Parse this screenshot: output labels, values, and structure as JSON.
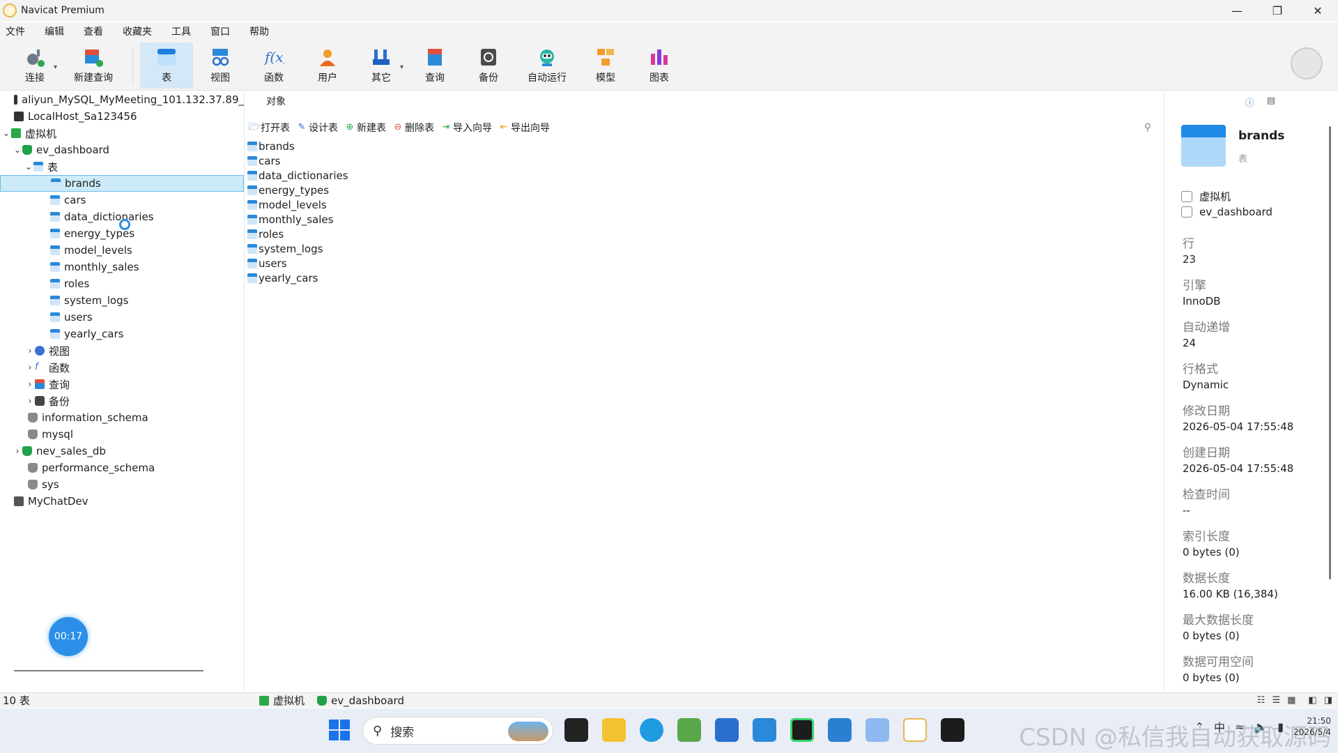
{
  "titlebar": {
    "title": "Navicat Premium"
  },
  "menu": [
    "文件",
    "编辑",
    "查看",
    "收藏夹",
    "工具",
    "窗口",
    "帮助"
  ],
  "toolbar": {
    "buttons": [
      {
        "label": "连接",
        "icon": "plug-icon"
      },
      {
        "label": "新建查询",
        "icon": "new-query-icon"
      },
      {
        "label": "表",
        "icon": "table-icon"
      },
      {
        "label": "视图",
        "icon": "view-icon"
      },
      {
        "label": "函数",
        "icon": "function-icon"
      },
      {
        "label": "用户",
        "icon": "user-icon"
      },
      {
        "label": "其它",
        "icon": "tools-icon"
      },
      {
        "label": "查询",
        "icon": "query-icon"
      },
      {
        "label": "备份",
        "icon": "backup-icon"
      },
      {
        "label": "自动运行",
        "icon": "robot-icon"
      },
      {
        "label": "模型",
        "icon": "model-icon"
      },
      {
        "label": "图表",
        "icon": "chart-icon"
      }
    ]
  },
  "tree": {
    "connections": [
      {
        "label": "aliyun_MySQL_MyMeeting_101.132.37.89_"
      },
      {
        "label": "LocalHost_Sa123456"
      },
      {
        "label": "虚拟机"
      }
    ],
    "database": "ev_dashboard",
    "tables_folder": "表",
    "tables": [
      "brands",
      "cars",
      "data_dictionaries",
      "energy_types",
      "model_levels",
      "monthly_sales",
      "roles",
      "system_logs",
      "users",
      "yearly_cars"
    ],
    "folders": [
      "视图",
      "函数",
      "查询",
      "备份"
    ],
    "other_dbs": [
      "information_schema",
      "mysql",
      "nev_sales_db",
      "performance_schema",
      "sys"
    ],
    "last_connection": "MyChatDev",
    "timer": "00:17"
  },
  "center": {
    "tab": "对象",
    "toolbar": [
      "打开表",
      "设计表",
      "新建表",
      "删除表",
      "导入向导",
      "导出向导"
    ],
    "objects": [
      "brands",
      "cars",
      "data_dictionaries",
      "energy_types",
      "model_levels",
      "monthly_sales",
      "roles",
      "system_logs",
      "users",
      "yearly_cars"
    ]
  },
  "details": {
    "name": "brands",
    "type": "表",
    "connection": "虚拟机",
    "database": "ev_dashboard",
    "props": [
      {
        "k": "行",
        "v": "23"
      },
      {
        "k": "引擎",
        "v": "InnoDB"
      },
      {
        "k": "自动递增",
        "v": "24"
      },
      {
        "k": "行格式",
        "v": "Dynamic"
      },
      {
        "k": "修改日期",
        "v": "2026-05-04 17:55:48"
      },
      {
        "k": "创建日期",
        "v": "2026-05-04 17:55:48"
      },
      {
        "k": "检查时间",
        "v": "--"
      },
      {
        "k": "索引长度",
        "v": "0 bytes (0)"
      },
      {
        "k": "数据长度",
        "v": "16.00 KB (16,384)"
      },
      {
        "k": "最大数据长度",
        "v": "0 bytes (0)"
      },
      {
        "k": "数据可用空间",
        "v": "0 bytes (0)"
      }
    ]
  },
  "status": {
    "count": "10 表",
    "connection": "虚拟机",
    "database": "ev_dashboard"
  },
  "taskbar": {
    "search_placeholder": "搜索",
    "ime": "中",
    "time": "21:50",
    "date": "2026/5/4",
    "watermark": "CSDN @私信我自动获取源码"
  }
}
